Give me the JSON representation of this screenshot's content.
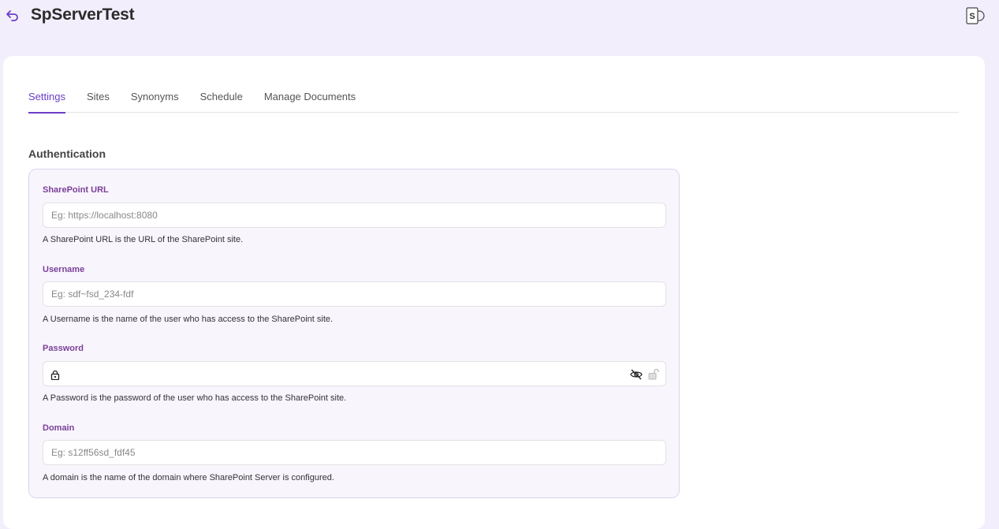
{
  "header": {
    "title": "SpServerTest",
    "back_icon": "undo-arrow-icon",
    "logo_icon": "sharepoint-logo-icon",
    "logo_letter": "S"
  },
  "tabs": [
    {
      "label": "Settings",
      "active": true
    },
    {
      "label": "Sites",
      "active": false
    },
    {
      "label": "Synonyms",
      "active": false
    },
    {
      "label": "Schedule",
      "active": false
    },
    {
      "label": "Manage Documents",
      "active": false
    }
  ],
  "section": {
    "title": "Authentication"
  },
  "fields": {
    "url": {
      "label": "SharePoint URL",
      "placeholder": "Eg: https://localhost:8080",
      "value": "",
      "help": "A SharePoint URL is the URL of the SharePoint site."
    },
    "username": {
      "label": "Username",
      "placeholder": "Eg: sdf~fsd_234-fdf",
      "value": "",
      "help": "A Username is the name of the user who has access to the SharePoint site."
    },
    "password": {
      "label": "Password",
      "placeholder": "",
      "value": "",
      "help": "A Password is the password of the user who has access to the SharePoint site."
    },
    "domain": {
      "label": "Domain",
      "placeholder": "Eg: s12ff56sd_fdf45",
      "value": "",
      "help": "A domain is the name of the domain where SharePoint Server is configured."
    }
  },
  "colors": {
    "accent": "#6a3fc7",
    "label": "#7b3f98",
    "background": "#f3eefb",
    "box": "#f8f5fd"
  }
}
